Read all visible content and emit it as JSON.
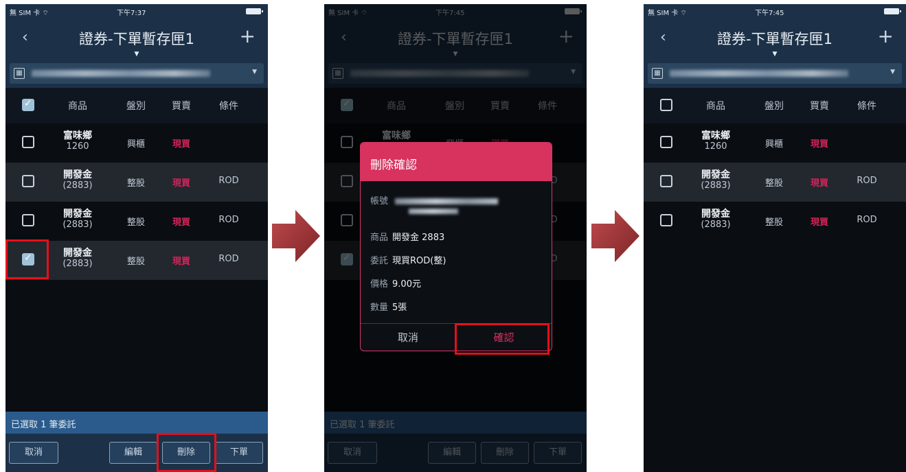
{
  "status": {
    "carrier": "無 SIM 卡 ⌔",
    "time_before": "下午7:37",
    "time_after": "下午7:45"
  },
  "nav": {
    "back": "‹",
    "title": "證券-下單暫存匣1",
    "caret": "▼",
    "add": "+"
  },
  "account": {
    "icon": "▦",
    "caret": "▼",
    "icons": {
      "grid": "grid-icon",
      "dropdown": "chevron-down-icon"
    }
  },
  "columns": [
    "商品",
    "盤別",
    "買賣",
    "條件"
  ],
  "orders": [
    {
      "name": "富味鄉",
      "code": "1260",
      "type": "興櫃",
      "side": "現買",
      "cond": "",
      "checked": false
    },
    {
      "name": "開發金",
      "code": "(2883)",
      "type": "整股",
      "side": "現買",
      "cond": "ROD",
      "checked": false
    },
    {
      "name": "開發金",
      "code": "(2883)",
      "type": "整股",
      "side": "現買",
      "cond": "ROD",
      "checked": false
    },
    {
      "name": "開發金",
      "code": "(2883)",
      "type": "整股",
      "side": "現買",
      "cond": "ROD",
      "checked": true
    }
  ],
  "selection": "已選取 1 筆委託",
  "actions": {
    "cancel": "取消",
    "edit": "編輯",
    "delete": "刪除",
    "order": "下單"
  },
  "dialog": {
    "title": "刪除確認",
    "account_label": "帳號",
    "product_label": "商品",
    "product_value": "開發金 2883",
    "order_label": "委託",
    "order_value": "現買ROD(整)",
    "price_label": "價格",
    "price_value": "9.00元",
    "qty_label": "數量",
    "qty_value": "5張",
    "cancel": "取消",
    "confirm": "確認"
  },
  "colors": {
    "nav_bg": "#1c3148",
    "buy": "#d4245a",
    "dialog_header": "#d8325f",
    "highlight": "#e4101b",
    "arrow": "#a3373a"
  }
}
